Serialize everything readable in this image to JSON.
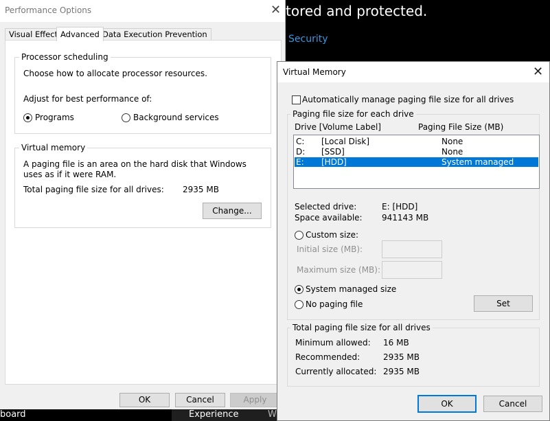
{
  "background": {
    "heading": "tored and protected.",
    "link": "Security",
    "bottom_left": "board",
    "bottom_mid": "Experience",
    "bottom_right": "W"
  },
  "perf": {
    "title": "Performance Options",
    "tabs": [
      "Visual Effects",
      "Advanced",
      "Data Execution Prevention"
    ],
    "processor": {
      "legend": "Processor scheduling",
      "desc": "Choose how to allocate processor resources.",
      "adjust": "Adjust for best performance of:",
      "opt_programs": "Programs",
      "opt_background": "Background services"
    },
    "vm": {
      "legend": "Virtual memory",
      "desc": "A paging file is an area on the hard disk that Windows uses as if it were RAM.",
      "total_label": "Total paging file size for all drives:",
      "total_value": "2935 MB",
      "change": "Change..."
    },
    "buttons": {
      "ok": "OK",
      "cancel": "Cancel",
      "apply": "Apply"
    }
  },
  "vmdlg": {
    "title": "Virtual Memory",
    "auto": "Automatically manage paging file size for all drives",
    "paging_legend": "Paging file size for each drive",
    "hdr_drive": "Drive  [Volume Label]",
    "hdr_size": "Paging File Size (MB)",
    "drives": [
      {
        "letter": "C:",
        "label": "[Local Disk]",
        "size": "None"
      },
      {
        "letter": "D:",
        "label": "[SSD]",
        "size": "None"
      },
      {
        "letter": "E:",
        "label": "[HDD]",
        "size": "System managed"
      }
    ],
    "selected_label": "Selected drive:",
    "selected_value": "E:  [HDD]",
    "space_label": "Space available:",
    "space_value": "941143 MB",
    "custom": "Custom size:",
    "initial": "Initial size (MB):",
    "maximum": "Maximum size (MB):",
    "system": "System managed size",
    "nopaging": "No paging file",
    "set": "Set",
    "total_legend": "Total paging file size for all drives",
    "min_label": "Minimum allowed:",
    "min_value": "16 MB",
    "rec_label": "Recommended:",
    "rec_value": "2935 MB",
    "cur_label": "Currently allocated:",
    "cur_value": "2935 MB",
    "ok": "OK",
    "cancel": "Cancel"
  }
}
